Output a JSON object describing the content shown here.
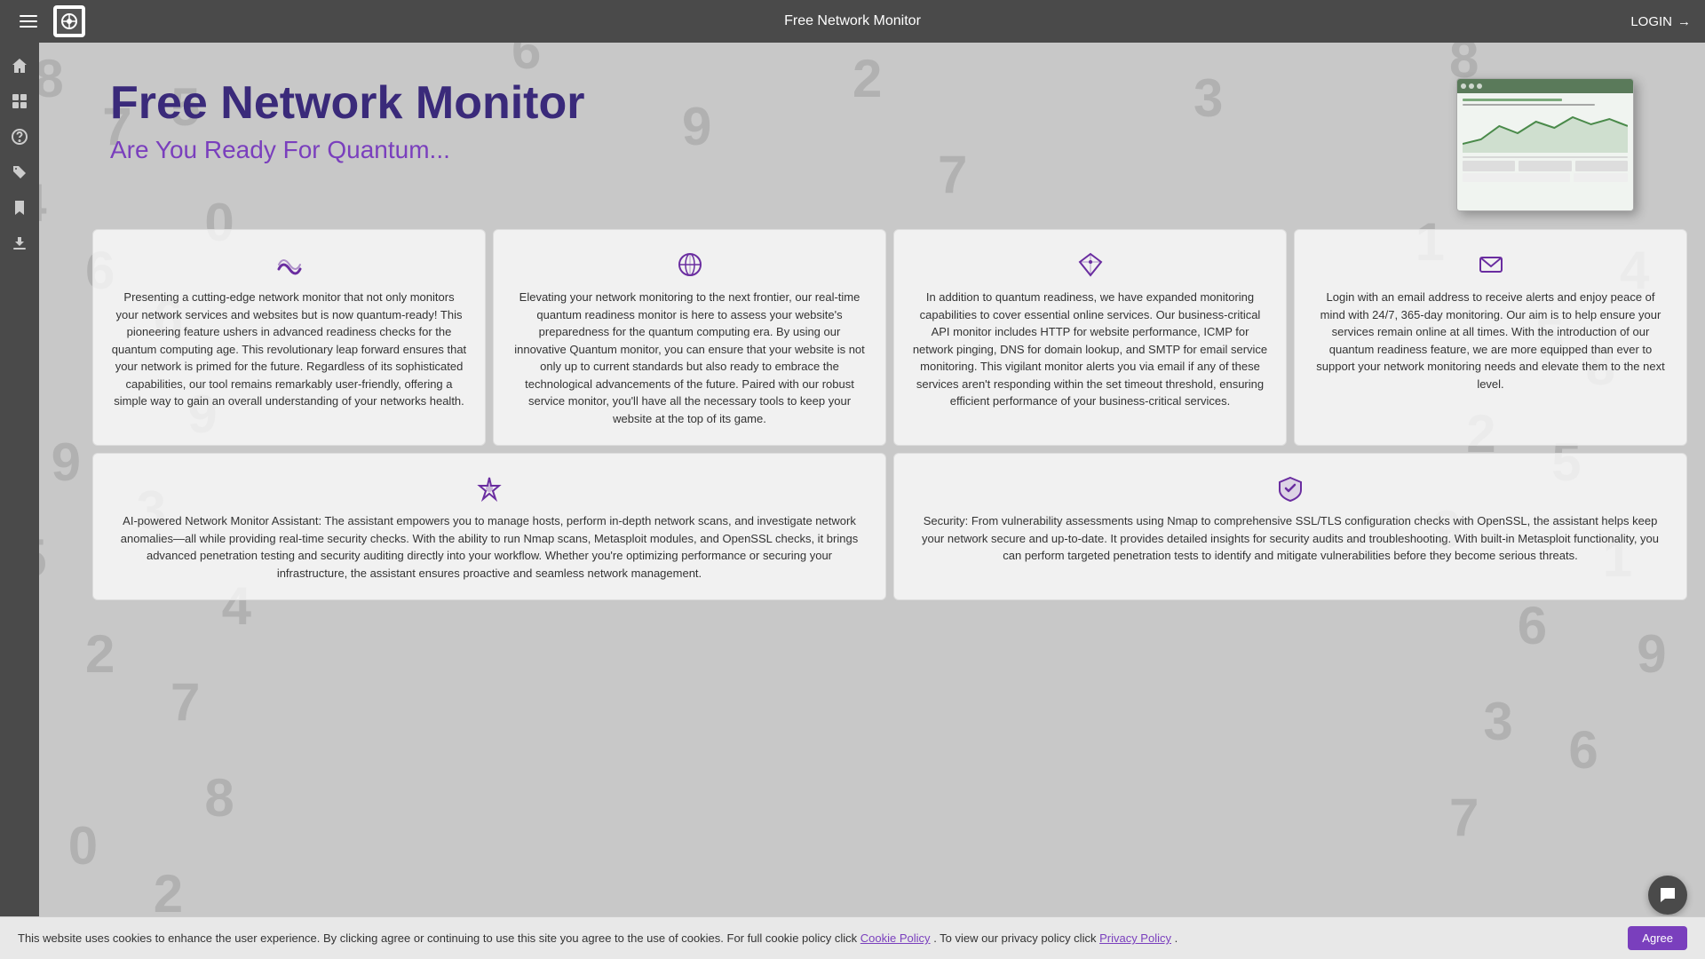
{
  "app": {
    "title": "Free Network Monitor",
    "logo_alt": "FNM Logo"
  },
  "topnav": {
    "title": "Free Network Monitor",
    "login_label": "LOGIN"
  },
  "sidebar": {
    "items": [
      {
        "icon": "home",
        "label": "Home"
      },
      {
        "icon": "dashboard",
        "label": "Dashboard"
      },
      {
        "icon": "help",
        "label": "Help"
      },
      {
        "icon": "tags",
        "label": "Tags"
      },
      {
        "icon": "bookmarks",
        "label": "Bookmarks"
      },
      {
        "icon": "download",
        "label": "Download"
      }
    ]
  },
  "hero": {
    "title": "Free Network Monitor",
    "subtitle": "Are You Ready For Quantum..."
  },
  "cards": {
    "row1": [
      {
        "icon": "wave",
        "text": "Presenting a cutting-edge network monitor that not only monitors your network services and websites but is now quantum-ready! This pioneering feature ushers in advanced readiness checks for the quantum computing age. This revolutionary leap forward ensures that your network is primed for the future. Regardless of its sophisticated capabilities, our tool remains remarkably user-friendly, offering a simple way to gain an overall understanding of your networks health."
      },
      {
        "icon": "globe",
        "text": "Elevating your network monitoring to the next frontier, our real-time quantum readiness monitor is here to assess your website's preparedness for the quantum computing era. By using our innovative Quantum monitor, you can ensure that your website is not only up to current standards but also ready to embrace the technological advancements of the future. Paired with our robust service monitor, you'll have all the necessary tools to keep your website at the top of its game."
      },
      {
        "icon": "diamond",
        "text": "In addition to quantum readiness, we have expanded monitoring capabilities to cover essential online services. Our business-critical API monitor includes HTTP for website performance, ICMP for network pinging, DNS for domain lookup, and SMTP for email service monitoring. This vigilant monitor alerts you via email if any of these services aren't responding within the set timeout threshold, ensuring efficient performance of your business-critical services."
      },
      {
        "icon": "mail",
        "text": "Login with an email address to receive alerts and enjoy peace of mind with 24/7, 365-day monitoring. Our aim is to help ensure your services remain online at all times. With the introduction of our quantum readiness feature, we are more equipped than ever to support your network monitoring needs and elevate them to the next level."
      }
    ],
    "row2": [
      {
        "icon": "star",
        "text": "AI-powered Network Monitor Assistant: The assistant empowers you to manage hosts, perform in-depth network scans, and investigate network anomalies—all while providing real-time security checks. With the ability to run Nmap scans, Metasploit modules, and OpenSSL checks, it brings advanced penetration testing and security auditing directly into your workflow. Whether you're optimizing performance or securing your infrastructure, the assistant ensures proactive and seamless network management."
      },
      {
        "icon": "shield",
        "text": "Security: From vulnerability assessments using Nmap to comprehensive SSL/TLS configuration checks with OpenSSL, the assistant helps keep your network secure and up-to-date. It provides detailed insights for security audits and troubleshooting. With built-in Metasploit functionality, you can perform targeted penetration tests to identify and mitigate vulnerabilities before they become serious threats."
      }
    ]
  },
  "cookie_bar": {
    "text": "This website uses cookies to enhance the user experience. By clicking agree or continuing to use this site you agree to the use of cookies. For full cookie policy click",
    "cookie_policy_link": "Cookie Policy",
    "privacy_text": ". To view our privacy policy click",
    "privacy_policy_link": "Privacy Policy",
    "agree_button": "Agree"
  }
}
